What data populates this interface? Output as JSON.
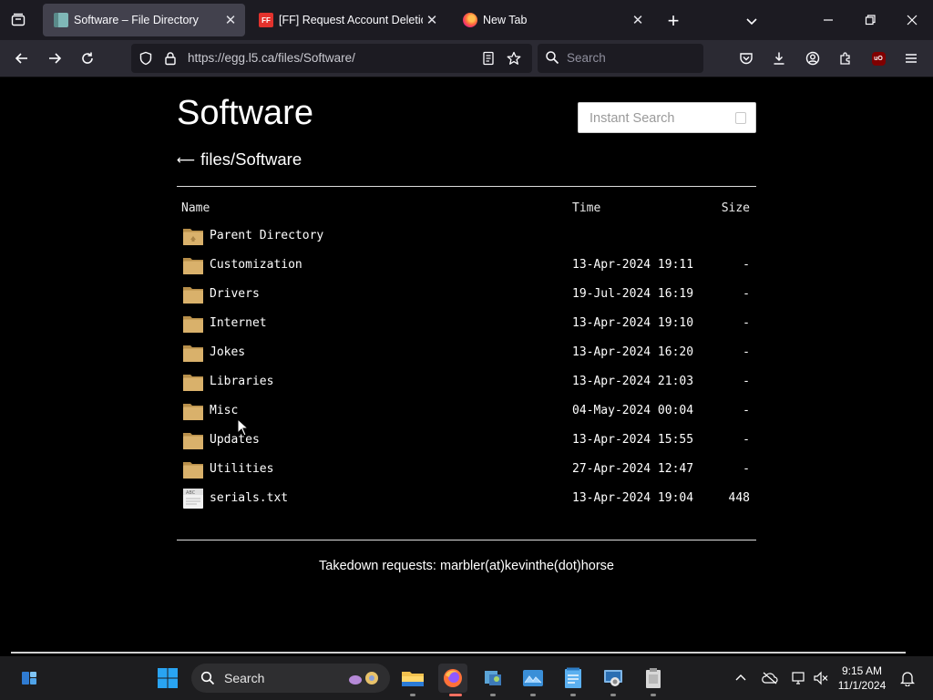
{
  "browser": {
    "tabs": [
      {
        "title": "Software – File Directory",
        "active": true
      },
      {
        "title": "[FF] Request Account Deletion",
        "active": false
      },
      {
        "title": "New Tab",
        "active": false
      }
    ],
    "url": "https://egg.l5.ca/files/Software/",
    "search_placeholder": "Search"
  },
  "page": {
    "heading": "Software",
    "instant_search_placeholder": "Instant Search",
    "breadcrumb": "files/Software",
    "columns": {
      "name": "Name",
      "time": "Time",
      "size": "Size"
    },
    "entries": [
      {
        "name": "Parent Directory",
        "time": "",
        "size": "",
        "type": "parent"
      },
      {
        "name": "Customization",
        "time": "13-Apr-2024 19:11",
        "size": "-",
        "type": "folder"
      },
      {
        "name": "Drivers",
        "time": "19-Jul-2024 16:19",
        "size": "-",
        "type": "folder"
      },
      {
        "name": "Internet",
        "time": "13-Apr-2024 19:10",
        "size": "-",
        "type": "folder"
      },
      {
        "name": "Jokes",
        "time": "13-Apr-2024 16:20",
        "size": "-",
        "type": "folder"
      },
      {
        "name": "Libraries",
        "time": "13-Apr-2024 21:03",
        "size": "-",
        "type": "folder"
      },
      {
        "name": "Misc",
        "time": "04-May-2024 00:04",
        "size": "-",
        "type": "folder"
      },
      {
        "name": "Updates",
        "time": "13-Apr-2024 15:55",
        "size": "-",
        "type": "folder"
      },
      {
        "name": "Utilities",
        "time": "27-Apr-2024 12:47",
        "size": "-",
        "type": "folder"
      },
      {
        "name": "serials.txt",
        "time": "13-Apr-2024 19:04",
        "size": "448",
        "type": "text"
      }
    ],
    "footer": "Takedown requests: marbler(at)kevinthe(dot)horse"
  },
  "taskbar": {
    "search_label": "Search",
    "time": "9:15 AM",
    "date": "11/1/2024"
  },
  "colors": {
    "folder": "#d9b16b",
    "tab_active": "#42414d",
    "firefox": "#ff7139",
    "windows_blue": "#0a7bd8"
  }
}
